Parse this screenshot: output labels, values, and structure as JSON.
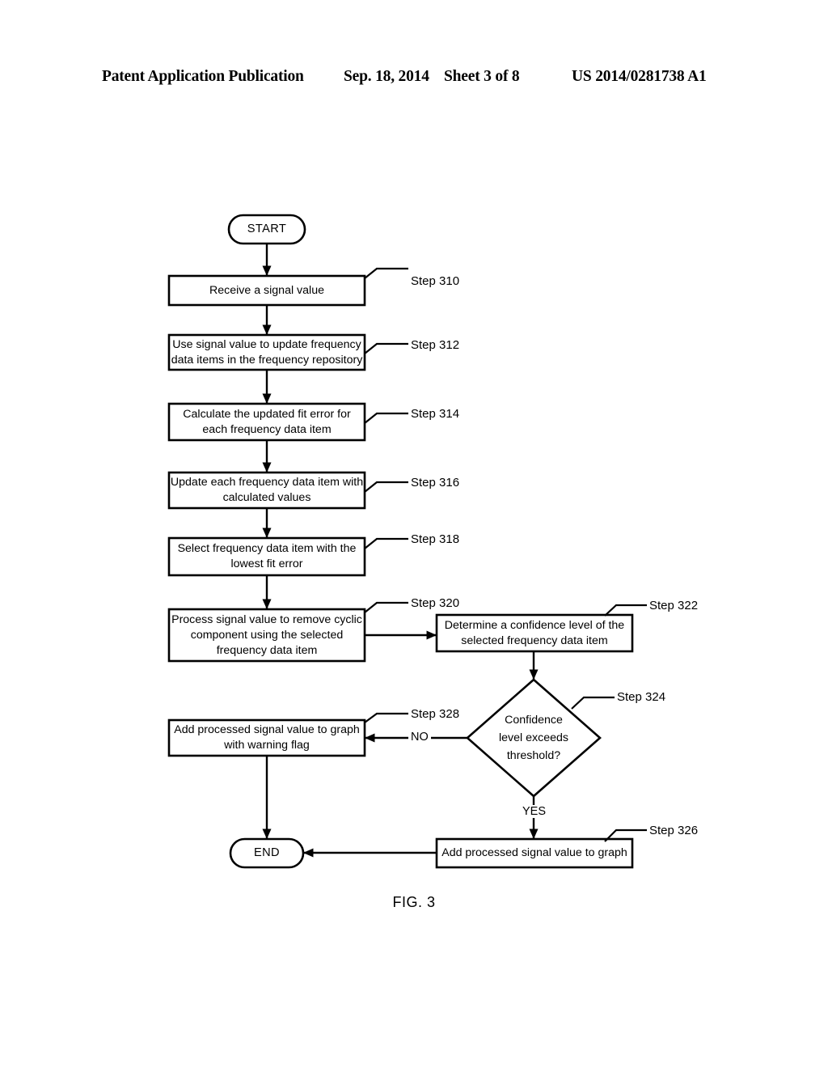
{
  "header": {
    "publication": "Patent Application Publication",
    "date": "Sep. 18, 2014",
    "sheet": "Sheet 3 of 8",
    "patent_number": "US 2014/0281738 A1"
  },
  "figure": {
    "caption": "FIG. 3"
  },
  "flowchart": {
    "terminals": {
      "start": "START",
      "end": "END"
    },
    "nodes": [
      {
        "id": "step310",
        "shape": "process",
        "text": "Receive a signal value",
        "step_label": "Step 310"
      },
      {
        "id": "step312",
        "shape": "process",
        "text": "Use signal value to update frequency\ndata items in the frequency repository",
        "step_label": "Step 312"
      },
      {
        "id": "step314",
        "shape": "process",
        "text": "Calculate the updated fit error for\neach frequency data item",
        "step_label": "Step 314"
      },
      {
        "id": "step316",
        "shape": "process",
        "text": "Update each frequency data item with\ncalculated values",
        "step_label": "Step 316"
      },
      {
        "id": "step318",
        "shape": "process",
        "text": "Select frequency data item with the\nlowest fit error",
        "step_label": "Step 318"
      },
      {
        "id": "step320",
        "shape": "process",
        "text": "Process signal value to remove cyclic\ncomponent using the selected\nfrequency data item",
        "step_label": "Step 320"
      },
      {
        "id": "step322",
        "shape": "process",
        "text": "Determine a confidence level of the\nselected frequency data item",
        "step_label": "Step 322"
      },
      {
        "id": "step324",
        "shape": "decision",
        "text": "Confidence\nlevel exceeds\nthreshold?",
        "step_label": "Step 324"
      },
      {
        "id": "step326",
        "shape": "process",
        "text": "Add processed signal value to graph",
        "step_label": "Step 326"
      },
      {
        "id": "step328",
        "shape": "process",
        "text": "Add processed signal value to graph\nwith warning flag",
        "step_label": "Step 328"
      }
    ],
    "edge_labels": {
      "no": "NO",
      "yes": "YES"
    },
    "colors": {
      "stroke": "#000000",
      "fill": "#ffffff",
      "text": "#000000"
    }
  }
}
